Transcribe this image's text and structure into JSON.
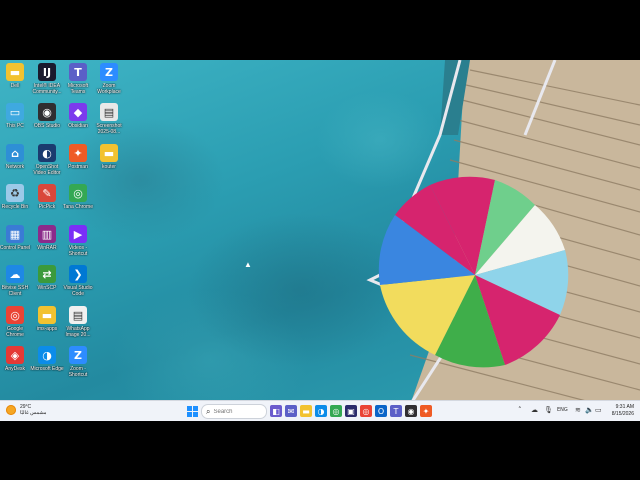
{
  "desktop": {
    "icons": [
      {
        "label": "Dell",
        "icon": "folder-icon",
        "color": "#f2c230"
      },
      {
        "label": "Intel® IDEA Community...",
        "icon": "intellij-icon",
        "color": "#1a1a2e"
      },
      {
        "label": "Microsoft Teams",
        "icon": "teams-icon",
        "color": "#5b5fc7"
      },
      {
        "label": "Zoom Workplace",
        "icon": "zoom-icon",
        "color": "#2d8cff"
      },
      {
        "label": "This PC",
        "icon": "computer-icon",
        "color": "#3fa9e0"
      },
      {
        "label": "OBS Studio",
        "icon": "obs-icon",
        "color": "#302e31"
      },
      {
        "label": "Obsidian",
        "icon": "obsidian-icon",
        "color": "#7c3aed"
      },
      {
        "label": "Screenshot 2025-08...",
        "icon": "image-file-icon",
        "color": "#e8e8e8"
      },
      {
        "label": "Network",
        "icon": "network-icon",
        "color": "#2e8fd6"
      },
      {
        "label": "OpenShot Video Editor",
        "icon": "openshot-icon",
        "color": "#1b3b6f"
      },
      {
        "label": "Postman",
        "icon": "postman-icon",
        "color": "#ef5b25"
      },
      {
        "label": "kouter",
        "icon": "folder-icon",
        "color": "#f2c230"
      },
      {
        "label": "Recycle Bin",
        "icon": "recycle-bin-icon",
        "color": "#9cc9e8"
      },
      {
        "label": "PicPick",
        "icon": "picpick-icon",
        "color": "#d9473b"
      },
      {
        "label": "Tana Chrome",
        "icon": "chrome-icon",
        "color": "#34a853"
      },
      {
        "label": "Control Panel",
        "icon": "control-panel-icon",
        "color": "#3a7bd5"
      },
      {
        "label": "WinRAR",
        "icon": "winrar-icon",
        "color": "#8b2a8b"
      },
      {
        "label": "Videos - Shortcut",
        "icon": "videos-icon",
        "color": "#7b2ff7"
      },
      {
        "label": "Bitvise SSH Client",
        "icon": "bitvise-icon",
        "color": "#1e88e5"
      },
      {
        "label": "WinSCP",
        "icon": "winscp-icon",
        "color": "#3b9a3b"
      },
      {
        "label": "Visual Studio Code",
        "icon": "vscode-icon",
        "color": "#0078d4"
      },
      {
        "label": "Google Chrome",
        "icon": "chrome-icon",
        "color": "#ea4335"
      },
      {
        "label": "ims-apps",
        "icon": "folder-icon",
        "color": "#f2c230"
      },
      {
        "label": "WhatsApp Image 20...",
        "icon": "image-file-icon",
        "color": "#f0f0f0"
      },
      {
        "label": "AnyDesk",
        "icon": "anydesk-icon",
        "color": "#e53935"
      },
      {
        "label": "Microsoft Edge",
        "icon": "edge-icon",
        "color": "#0c8ce9"
      },
      {
        "label": "Zoom - Shortcut",
        "icon": "zoom-icon",
        "color": "#2d8cff"
      }
    ]
  },
  "taskbar": {
    "weather_temp": "29°C",
    "weather_desc": "مشمس غالبًا",
    "search_placeholder": "Search",
    "apps": [
      {
        "icon": "windows-start-icon",
        "color": "#1e90ff"
      },
      {
        "icon": "search-icon",
        "color": "#555555"
      },
      {
        "icon": "widgets-icon",
        "color": "#6a5acd"
      },
      {
        "icon": "chat-icon",
        "color": "#5b5fc7"
      },
      {
        "icon": "file-explorer-icon",
        "color": "#f2c230"
      },
      {
        "icon": "edge-icon",
        "color": "#0c8ce9"
      },
      {
        "icon": "chrome-icon",
        "color": "#34a853"
      },
      {
        "icon": "store-icon",
        "color": "#2b2b6b"
      },
      {
        "icon": "chrome-icon",
        "color": "#ea4335"
      },
      {
        "icon": "outlook-icon",
        "color": "#0a64c8"
      },
      {
        "icon": "teams-icon",
        "color": "#5b5fc7"
      },
      {
        "icon": "obs-icon",
        "color": "#302e31"
      },
      {
        "icon": "postman-icon",
        "color": "#ef5b25"
      }
    ],
    "tray": {
      "language": "ENG",
      "time": "9:31 AM",
      "date": "8/15/2026"
    }
  }
}
